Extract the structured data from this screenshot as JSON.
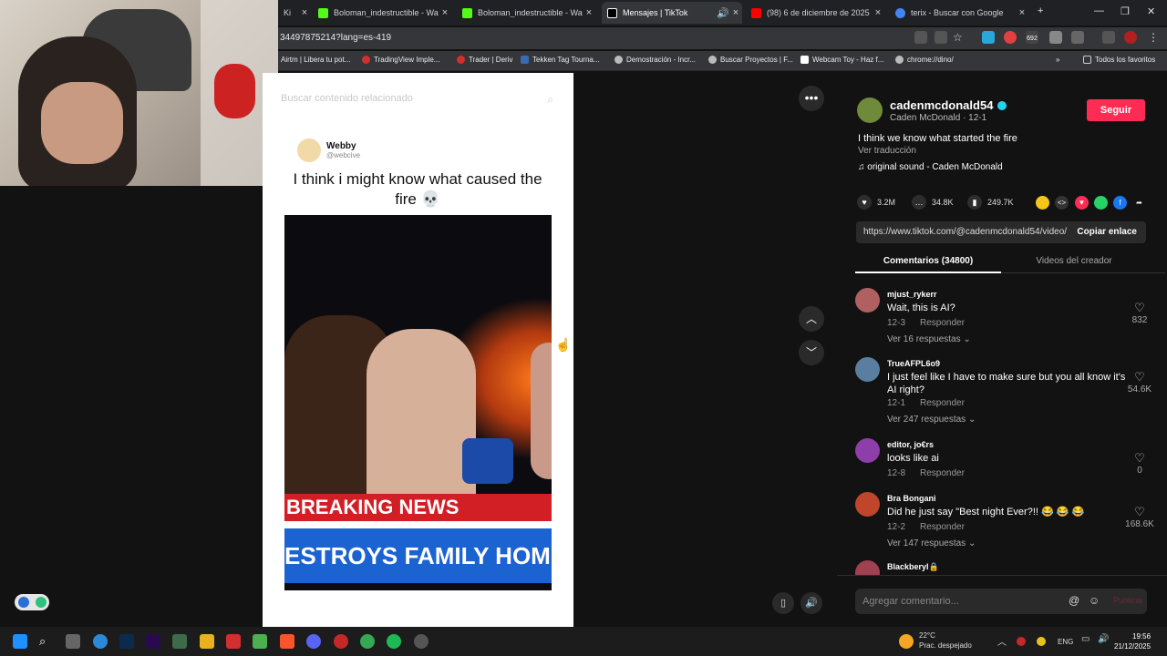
{
  "browser": {
    "tabs": [
      {
        "label": "Boloman_indestructible - Watch",
        "color": "#53fc18"
      },
      {
        "label": "Boloman_indestructible - Watch",
        "color": "#53fc18"
      },
      {
        "label": "Mensajes | TikTok",
        "color": "#ffffff"
      },
      {
        "label": "(98) 6 de diciembre de 2025 - Y",
        "color": "#ff0000"
      },
      {
        "label": "terix - Buscar con Google",
        "color": "#4285f4"
      }
    ],
    "first_tab_partial": "Ki",
    "url": "34497875214?lang=es-419",
    "bookmarks": [
      "Airtm | Libera tu pot...",
      "TradingView Imple...",
      "Trader | Deriv",
      "Tekken Tag Tourna...",
      "Demostración - Incr...",
      "Buscar Proyectos | F...",
      "Webcam Toy - Haz f...",
      "chrome://dino/"
    ],
    "all_favorites": "Todos los favoritos",
    "badge_count": "692"
  },
  "video": {
    "search_placeholder": "Buscar contenido relacionado",
    "tweet_name": "Webby",
    "tweet_handle": "@webcive",
    "tweet_text": "I think i might know what caused the fire 💀",
    "breaking": "BREAKING NEWS",
    "headline": "ESTROYS FAMILY HOM"
  },
  "post": {
    "username": "cadenmcdonald54",
    "display": "Caden McDonald · 12-1",
    "follow": "Seguir",
    "description": "I think we know what started the fire",
    "translate": "Ver traducción",
    "sound": "original sound - Caden McDonald",
    "likes": "3.2M",
    "comments": "34.8K",
    "saves": "249.7K",
    "link": "https://www.tiktok.com/@cadenmcdonald54/video/",
    "copy": "Copiar enlace",
    "tab_comments": "Comentarios (34800)",
    "tab_videos": "Videos del creador",
    "comment_placeholder": "Agregar comentario...",
    "post_label": "Publicar"
  },
  "comments": [
    {
      "user": "mjust_rykerr",
      "text": "Wait, this is AI?",
      "date": "12-3",
      "reply": "Responder",
      "likes": "832",
      "replies": "Ver 16 respuestas",
      "color": "#b06060"
    },
    {
      "user": "TrueAFPL6o9",
      "text": "I just feel like I have to make sure but you all know it's AI right?",
      "date": "12-1",
      "reply": "Responder",
      "likes": "54.6K",
      "replies": "Ver 247 respuestas",
      "color": "#5a7ea0"
    },
    {
      "user": "editor, jo€rs",
      "text": "looks like ai",
      "date": "12-8",
      "reply": "Responder",
      "likes": "0",
      "replies": "",
      "color": "#8e3ea8"
    },
    {
      "user": "Bra Bongani",
      "text": "Did he just say \"Best night Ever?!! 😂 😂 😂",
      "date": "12-2",
      "reply": "Responder",
      "likes": "168.6K",
      "replies": "Ver 147 respuestas",
      "color": "#c0452a"
    },
    {
      "user": "Blackberyl🔒",
      "text": "",
      "date": "",
      "reply": "",
      "likes": "",
      "replies": "",
      "color": "#a04050"
    }
  ],
  "taskbar": {
    "weather_temp": "22°C",
    "weather_desc": "Prac. despejado",
    "lang": "ENG",
    "time": "19:56",
    "date": "21/12/2025"
  }
}
